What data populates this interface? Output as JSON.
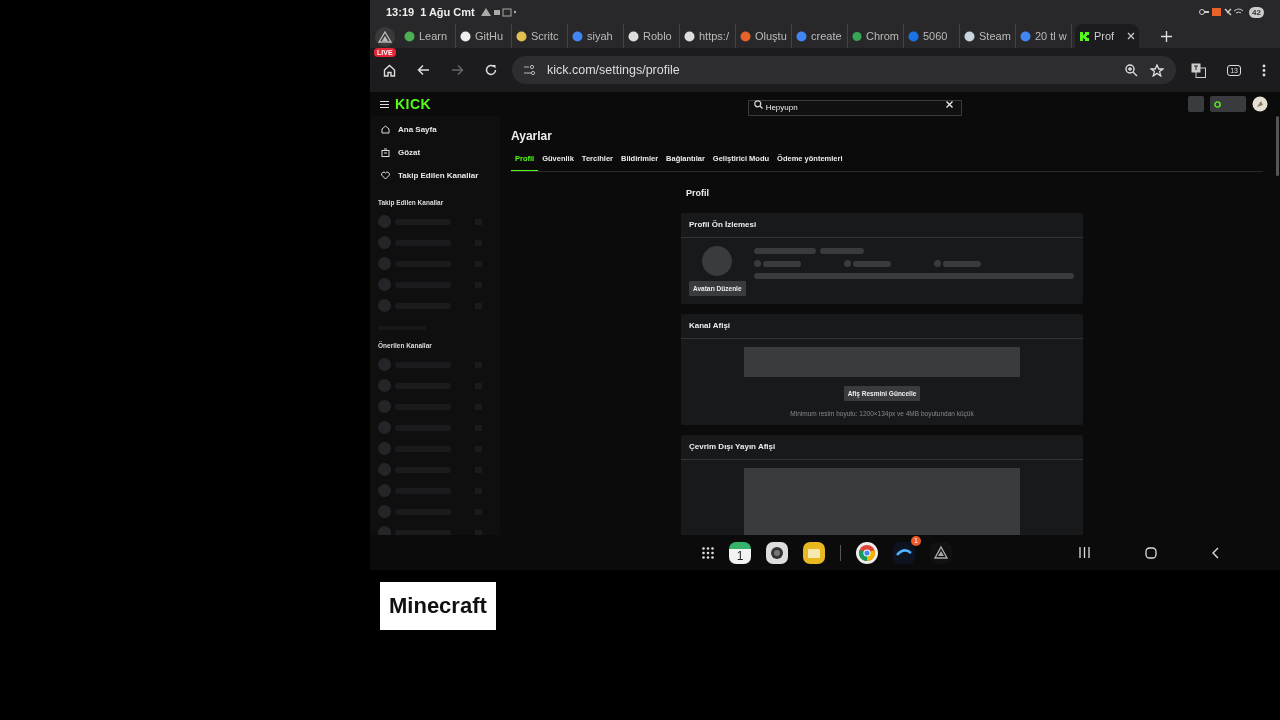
{
  "status_bar": {
    "time": "13:19",
    "date": "1 Ağu Cmt",
    "battery": "42"
  },
  "browser": {
    "live_badge": "LIVE",
    "tabs": [
      {
        "label": "Learn",
        "selected": false
      },
      {
        "label": "GitHu",
        "selected": false
      },
      {
        "label": "Scritc",
        "selected": false
      },
      {
        "label": "siyah",
        "selected": false
      },
      {
        "label": "Roblo",
        "selected": false
      },
      {
        "label": "https:/",
        "selected": false
      },
      {
        "label": "Oluştu",
        "selected": false
      },
      {
        "label": "create",
        "selected": false
      },
      {
        "label": "Chrom",
        "selected": false
      },
      {
        "label": "5060",
        "selected": false
      },
      {
        "label": "Steam",
        "selected": false
      },
      {
        "label": "20 tl w",
        "selected": false
      },
      {
        "label": "Prof",
        "selected": true
      }
    ],
    "url": "kick.com/settings/profile",
    "tab_count": "13"
  },
  "site": {
    "logo": "KICK",
    "search": {
      "value": "Hepyupn"
    },
    "nav": [
      {
        "label": "Ana Sayfa"
      },
      {
        "label": "Gözat"
      },
      {
        "label": "Takip Edilen Kanallar"
      }
    ],
    "sidebar_sections": [
      {
        "title": "Takip Edilen Kanallar"
      },
      {
        "title": "Önerilen Kanallar"
      }
    ]
  },
  "settings": {
    "title": "Ayarlar",
    "tabs": [
      {
        "label": "Profil",
        "selected": true
      },
      {
        "label": "Güvenlik",
        "selected": false
      },
      {
        "label": "Tercihler",
        "selected": false
      },
      {
        "label": "Bildirimler",
        "selected": false
      },
      {
        "label": "Bağlantılar",
        "selected": false
      },
      {
        "label": "Geliştirici Modu",
        "selected": false
      },
      {
        "label": "Ödeme yöntemleri",
        "selected": false
      }
    ],
    "section_title": "Profil",
    "cards": [
      {
        "kind": "preview",
        "title": "Profil Ön İzlemesi",
        "button": "Avatarı Düzenle"
      },
      {
        "kind": "banner",
        "title": "Kanal Afişi",
        "button": "Afiş Resmini Güncelle",
        "note": "Minimum resim boyutu: 1200×134px ve 4MB boyutundan küçük"
      },
      {
        "kind": "offline",
        "title": "Çevrim Dışı Yayın Afişi"
      }
    ]
  },
  "taskbar": {
    "calendar_day": "1",
    "badge": "1"
  },
  "overlay": {
    "label": "Minecraft"
  }
}
